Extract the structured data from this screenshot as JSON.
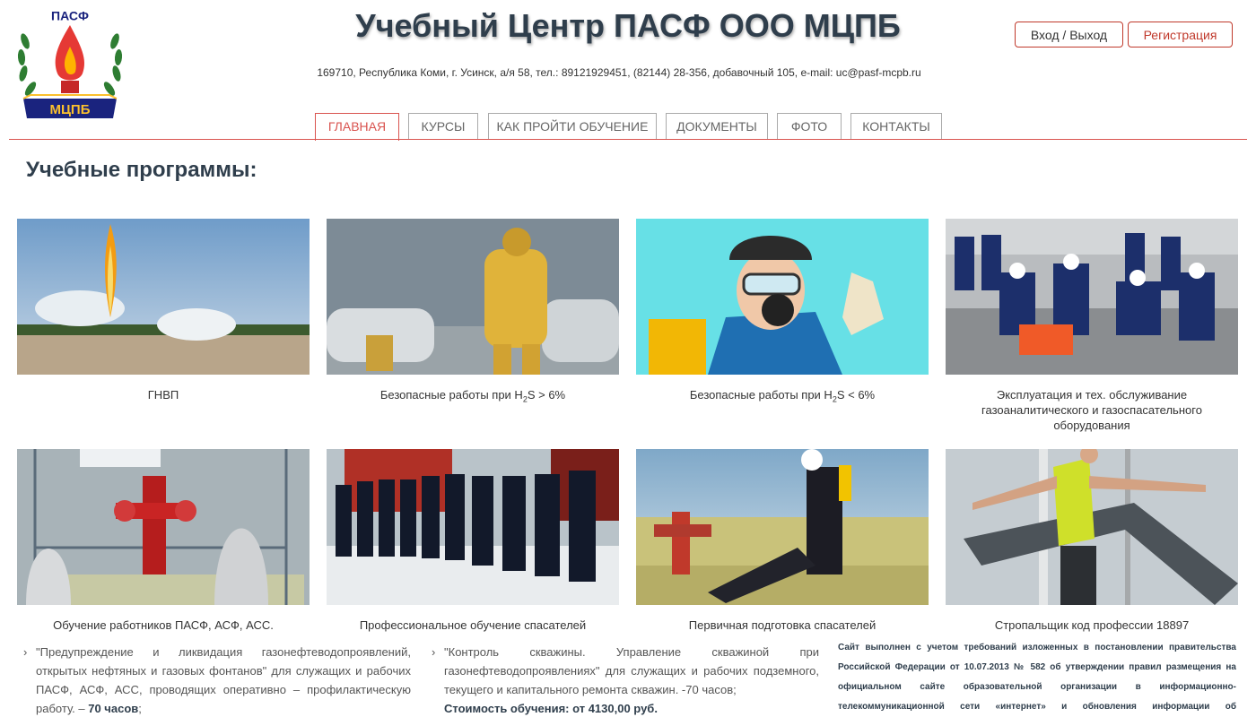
{
  "header": {
    "logo_top_text": "ПАСФ",
    "logo_bottom_text": "МЦПБ",
    "site_title": "Учебный Центр ПАСФ ООО МЦПБ",
    "address": "169710, Республика Коми, г. Усинск, а/я 58, тел.: 89121929451, (82144) 28-356, добавочный 105, e-mail: uc@pasf-mcpb.ru",
    "login_label": "Вход / Выход",
    "register_label": "Регистрация"
  },
  "nav": {
    "tabs": [
      {
        "label": "ГЛАВНАЯ",
        "active": true
      },
      {
        "label": "КУРСЫ",
        "active": false
      },
      {
        "label": "КАК ПРОЙТИ ОБУЧЕНИЕ",
        "active": false
      },
      {
        "label": "ДОКУМЕНТЫ",
        "active": false
      },
      {
        "label": "ФОТО",
        "active": false
      },
      {
        "label": "КОНТАКТЫ",
        "active": false
      }
    ]
  },
  "main": {
    "section_title": "Учебные программы:",
    "cards": [
      {
        "caption": "ГНВП"
      },
      {
        "caption_pre": "Безопасные работы при H",
        "caption_sub": "2",
        "caption_post": "S > 6%"
      },
      {
        "caption_pre": "Безопасные работы при H",
        "caption_sub": "2",
        "caption_post": "S < 6%"
      },
      {
        "caption": "Эксплуатация и тех. обслуживание газоаналитического и газоспасательного оборудования"
      },
      {
        "caption": "Обучение работников ПАСФ, АСФ, АСС."
      },
      {
        "caption": "Профессиональное обучение спасателей"
      },
      {
        "caption": "Первичная подготовка спасателей"
      },
      {
        "caption": "Стропальщик код профессии 18897"
      }
    ],
    "programs": [
      {
        "text": "\"Предупреждение и ликвидация газонефтеводопроявлений, открытых нефтяных и газовых фонтанов\" для служащих и рабочих ПАСФ, АСФ, АСС, проводящих оперативно – профилактическую работу. –",
        "hours": "70 часов",
        "tail": ";"
      },
      {
        "text": "\"Контроль скважины. Управление скважиной при газонефтеводопроявлениях\" для служащих и рабочих подземного, текущего и капитального ремонта скважин. -70 часов;",
        "price": "Стоимость обучения: от 4130,00 руб."
      }
    ],
    "legal_note": "Сайт выполнен с учетом требований изложенных в постановлении правительства Российской Федерации от 10.07.2013 № 582 об утверждении правил размещения на официальном сайте образовательной организации в информационно-телекоммуникационной сети «интернет» и обновления информации об образовательной"
  },
  "colors": {
    "accent": "#d9534f",
    "title": "#2f3e4c"
  }
}
